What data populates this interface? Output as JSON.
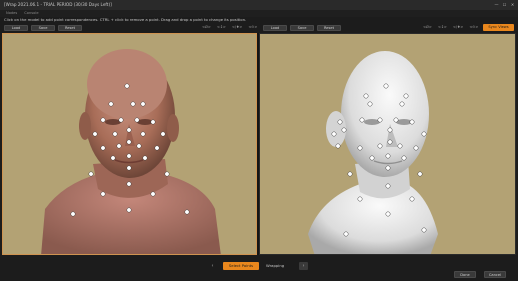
{
  "window": {
    "title": "[Wrap 2021.06.1 - TRIAL PERIOD (30/30 Days Left)]"
  },
  "menu": [
    "Nodes",
    "Console"
  ],
  "instructions": "Click on the model to add point correspondences. CTRL + click to remove a point. Drag and drop a point to change its position.",
  "left_toolbar": {
    "load": "Load",
    "save": "Save",
    "reset": "Reset",
    "nav": [
      "<Ø>",
      "<↕>",
      "</♦>",
      "<⊙>"
    ]
  },
  "right_toolbar": {
    "load": "Load",
    "save": "Save",
    "reset": "Reset",
    "nav": [
      "<Ø>",
      "<↕>",
      "</♦>",
      "<⊙>"
    ],
    "sync": "Sync Views"
  },
  "bottom": {
    "select_points": "Select Points",
    "wrapping": "Wrapping",
    "prev": "‹",
    "next": "›",
    "done": "Done",
    "cancel": "Cancel"
  },
  "colors": {
    "accent": "#e9871d",
    "viewport_bg": "#b3a274",
    "skin": "#b07a64",
    "sculpt": "#ececec"
  },
  "icons": {
    "minimize": "minimize-icon",
    "maximize": "maximize-icon",
    "close": "close-icon"
  }
}
